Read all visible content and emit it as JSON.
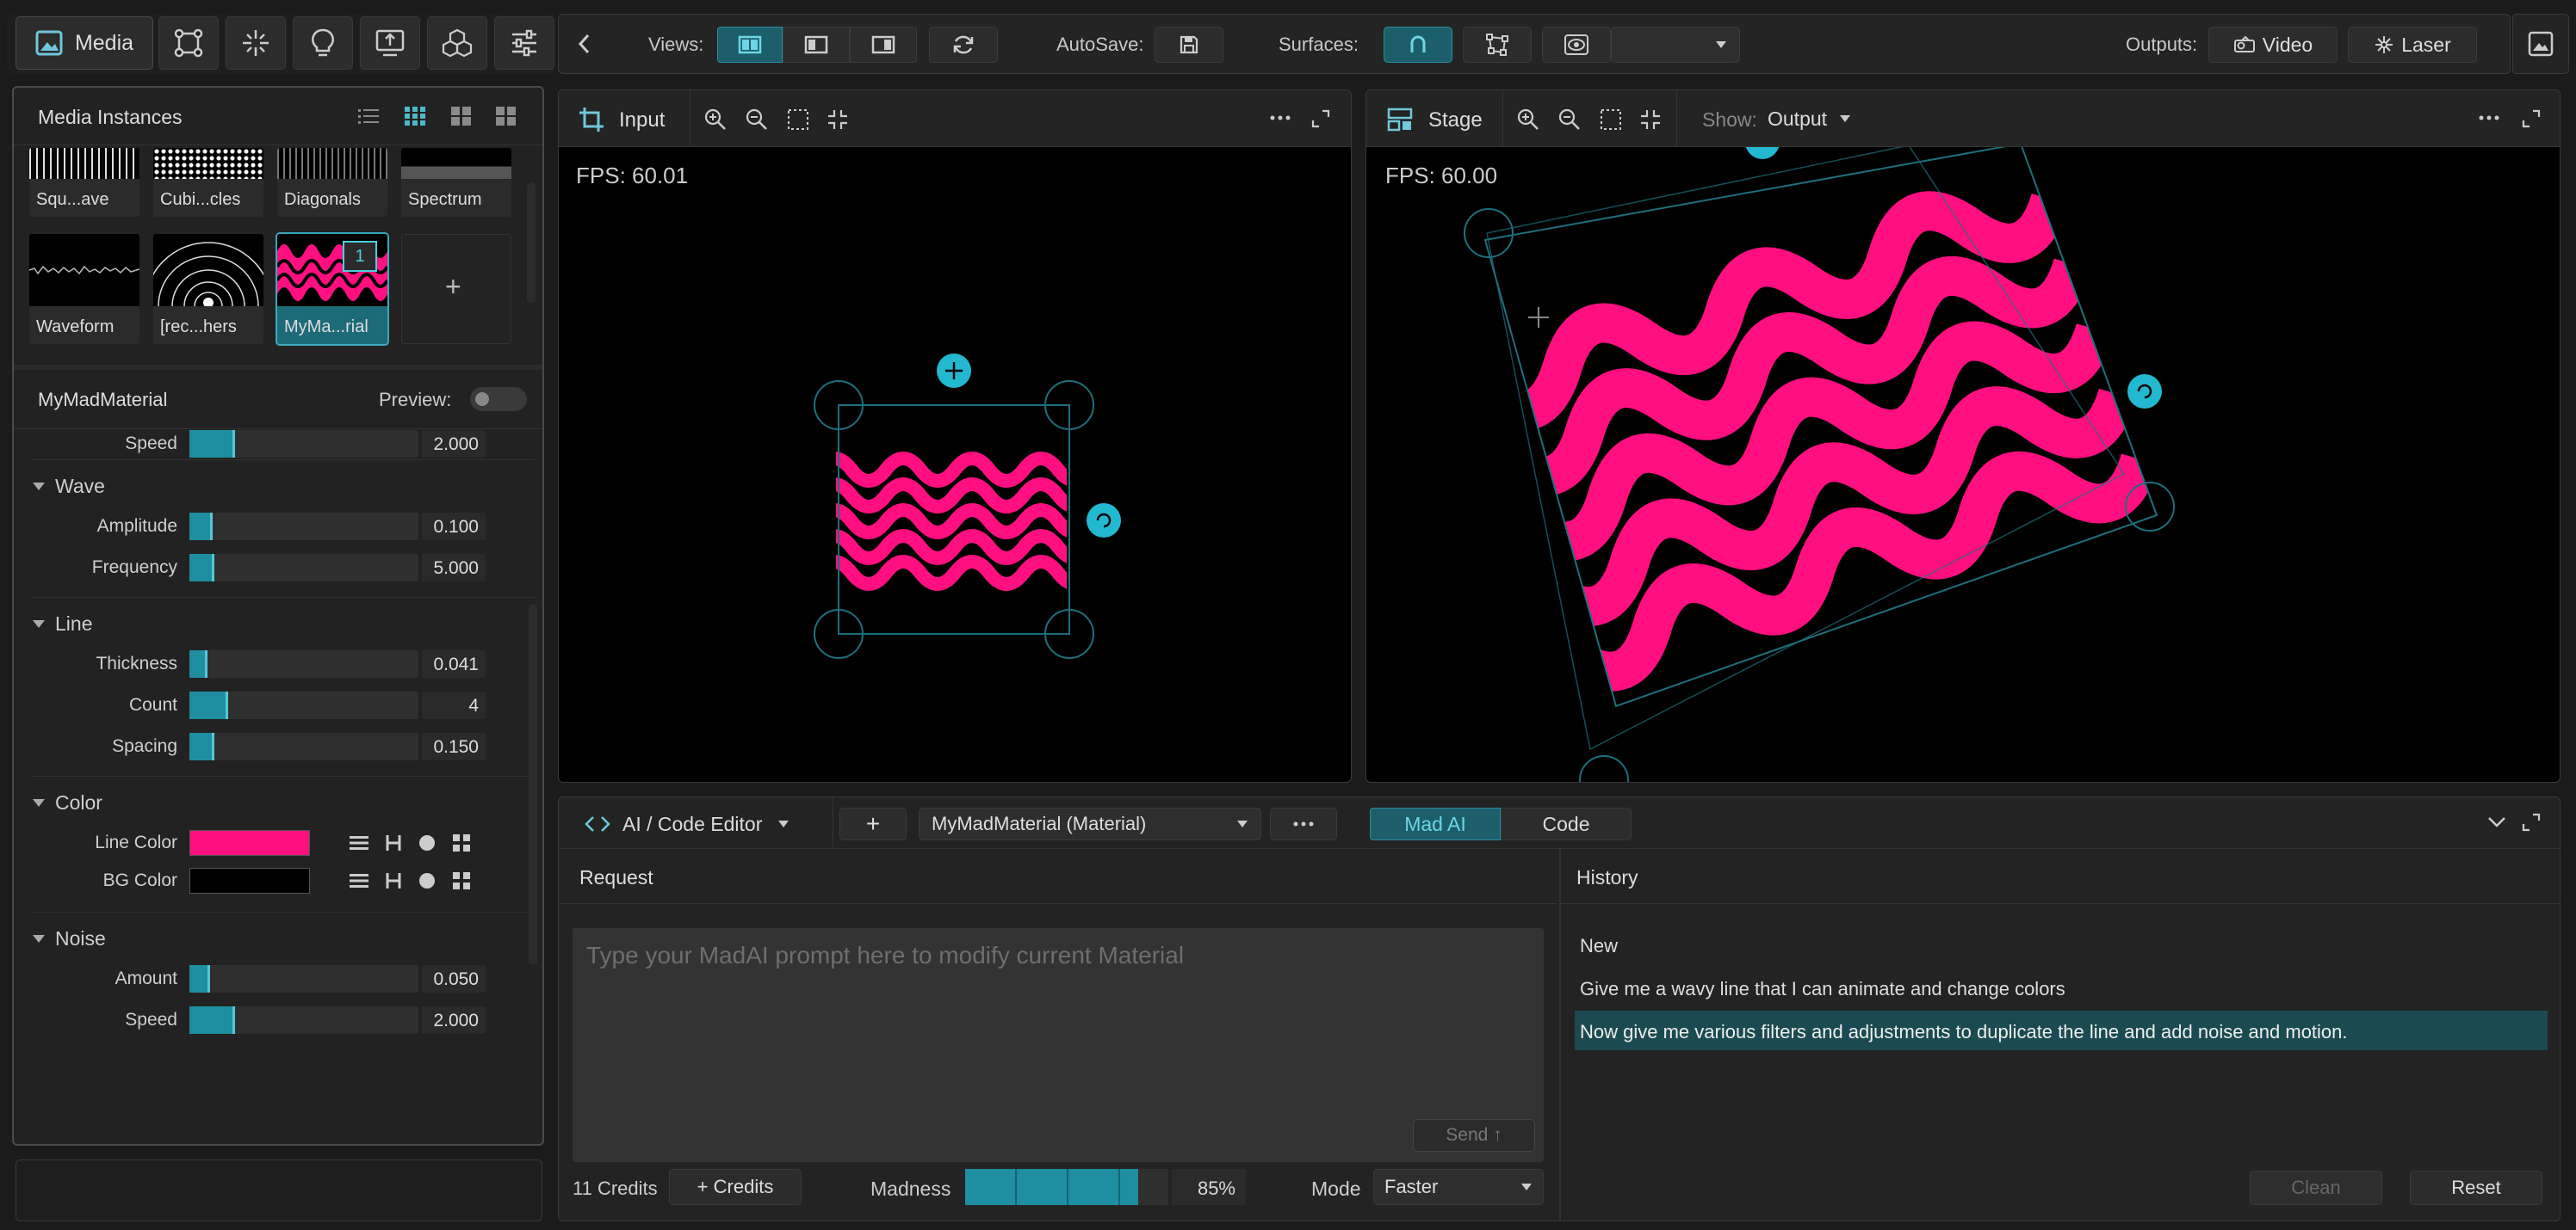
{
  "toolbar": {
    "media_label": "Media",
    "views_label": "Views:",
    "autosave_label": "AutoSave:",
    "surfaces_label": "Surfaces:",
    "outputs_label": "Outputs:",
    "video_label": "Video",
    "laser_label": "Laser"
  },
  "media_panel": {
    "title": "Media Instances",
    "thumbnails": [
      {
        "label": "Squ...ave"
      },
      {
        "label": "Cubi...cles"
      },
      {
        "label": "Diagonals"
      },
      {
        "label": "Spectrum"
      },
      {
        "label": "Waveform"
      },
      {
        "label": "[rec...hers"
      },
      {
        "label": "MyMa...rial",
        "badge": "1",
        "selected": true
      }
    ],
    "add_symbol": "+"
  },
  "material": {
    "name": "MyMadMaterial",
    "preview_label": "Preview:",
    "top_param": {
      "label": "Speed",
      "value": "2.000",
      "fraction": 0.2
    },
    "sections": [
      {
        "title": "Wave",
        "params": [
          {
            "label": "Amplitude",
            "value": "0.100",
            "fraction": 0.1
          },
          {
            "label": "Frequency",
            "value": "5.000",
            "fraction": 0.11
          }
        ]
      },
      {
        "title": "Line",
        "params": [
          {
            "label": "Thickness",
            "value": "0.041",
            "fraction": 0.08
          },
          {
            "label": "Count",
            "value": "4",
            "fraction": 0.17
          },
          {
            "label": "Spacing",
            "value": "0.150",
            "fraction": 0.11
          }
        ]
      },
      {
        "title": "Color",
        "colors": [
          {
            "label": "Line Color",
            "color": "#ff0f80"
          },
          {
            "label": "BG Color",
            "color": "#000000"
          }
        ]
      },
      {
        "title": "Noise",
        "params": [
          {
            "label": "Amount",
            "value": "0.050",
            "fraction": 0.09
          },
          {
            "label": "Speed",
            "value": "2.000",
            "fraction": 0.2
          }
        ]
      }
    ]
  },
  "input_view": {
    "title": "Input",
    "fps": "FPS: 60.01"
  },
  "stage_view": {
    "title": "Stage",
    "show_label": "Show:",
    "show_value": "Output",
    "fps": "FPS: 60.00"
  },
  "editor": {
    "mode_label": "AI / Code Editor",
    "add_symbol": "+",
    "material_select": "MyMadMaterial (Material)",
    "tab_ai": "Mad AI",
    "tab_code": "Code",
    "request_title": "Request",
    "prompt_placeholder": "Type your MadAI prompt here to modify current Material",
    "send_label": "Send ↑",
    "credits": "11 Credits",
    "add_credits": "+ Credits",
    "madness_label": "Madness",
    "madness_value": "85%",
    "madness_fraction": 0.85,
    "mode_text": "Mode",
    "mode_value": "Faster",
    "history_title": "History",
    "history": [
      "New",
      "Give me a wavy line that I can animate and change colors",
      "Now give me various filters and adjustments to duplicate the line and add noise and motion."
    ],
    "clean_label": "Clean",
    "reset_label": "Reset"
  },
  "colors": {
    "accent": "#1e8ea0",
    "wave": "#ff0f80",
    "handle": "#22b8d0"
  }
}
